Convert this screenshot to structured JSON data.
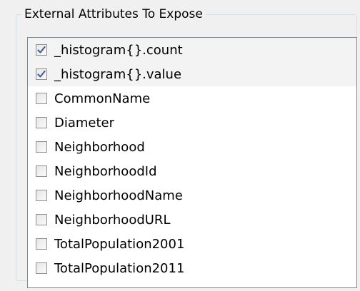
{
  "group": {
    "title": "External Attributes To Expose"
  },
  "attributes": [
    {
      "label": "_histogram{}.count",
      "checked": true
    },
    {
      "label": "_histogram{}.value",
      "checked": true
    },
    {
      "label": "CommonName",
      "checked": false
    },
    {
      "label": "Diameter",
      "checked": false
    },
    {
      "label": "Neighborhood",
      "checked": false
    },
    {
      "label": "NeighborhoodId",
      "checked": false
    },
    {
      "label": "NeighborhoodName",
      "checked": false
    },
    {
      "label": "NeighborhoodURL",
      "checked": false
    },
    {
      "label": "TotalPopulation2001",
      "checked": false
    },
    {
      "label": "TotalPopulation2011",
      "checked": false
    }
  ],
  "colors": {
    "checkmark": "#4a5f97",
    "checked_row_bg": "#f3f3f3",
    "list_border": "#828790"
  }
}
